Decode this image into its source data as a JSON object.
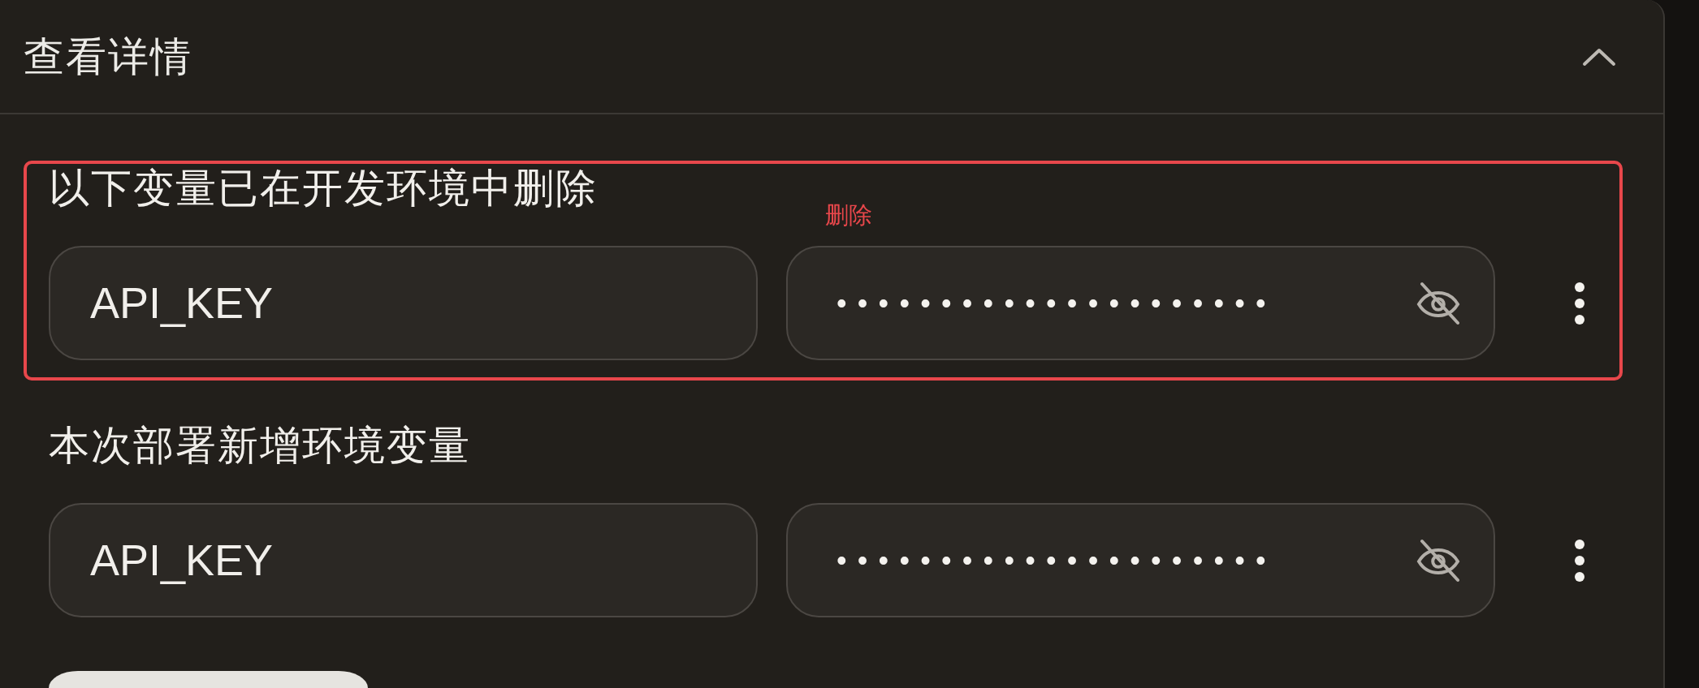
{
  "header": {
    "title": "查看详情",
    "expanded": true
  },
  "sections": [
    {
      "label": "以下变量已在开发环境中删除",
      "annotation": {
        "label": "删除"
      },
      "variables": [
        {
          "key": "API_KEY",
          "value": "•••••••••••••••••••••",
          "masked": true
        }
      ]
    },
    {
      "label": "本次部署新增环境变量",
      "variables": [
        {
          "key": "API_KEY",
          "value": "•••••••••••••••••••••",
          "masked": true
        }
      ]
    }
  ]
}
